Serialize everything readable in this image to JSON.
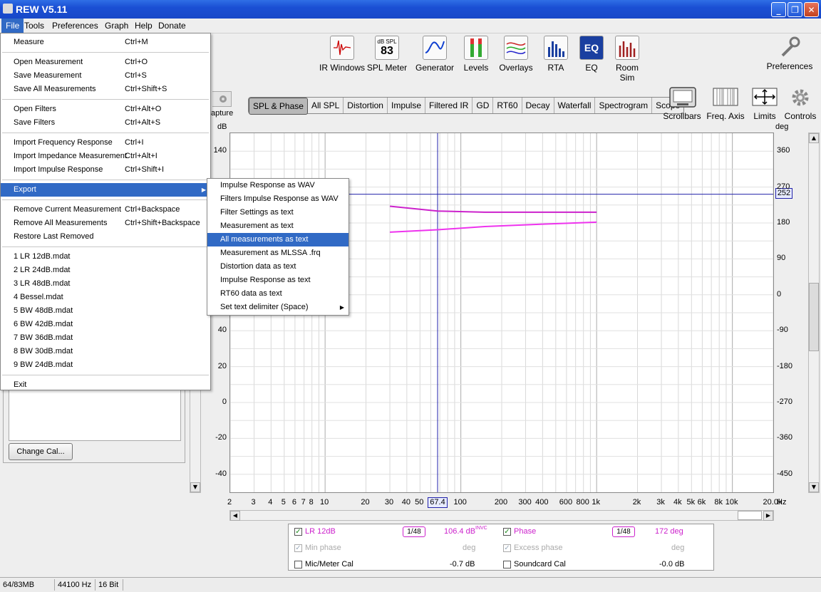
{
  "window": {
    "title": "REW V5.11"
  },
  "menubar": [
    {
      "label": "File",
      "active": true
    },
    {
      "label": "Tools"
    },
    {
      "label": "Preferences"
    },
    {
      "label": "Graph"
    },
    {
      "label": "Help"
    },
    {
      "label": "Donate"
    }
  ],
  "toolbar": {
    "ir_windows": "IR Windows",
    "spl_meter": "SPL Meter",
    "spl_meter_unit": "dB SPL",
    "spl_meter_value": "83",
    "generator": "Generator",
    "levels": "Levels",
    "overlays": "Overlays",
    "rta": "RTA",
    "eq": "EQ",
    "eq_icon_text": "EQ",
    "room_sim": "Room Sim",
    "preferences": "Preferences"
  },
  "capture_label": "apture",
  "tabs": [
    "SPL & Phase",
    "All SPL",
    "Distortion",
    "Impulse",
    "Filtered IR",
    "GD",
    "RT60",
    "Decay",
    "Waterfall",
    "Spectrogram",
    "Scope"
  ],
  "selected_tab": "SPL & Phase",
  "right_tools": {
    "scrollbars": "Scrollbars",
    "freq_axis": "Freq. Axis",
    "limits": "Limits",
    "controls": "Controls"
  },
  "file_menu": {
    "items": [
      {
        "label": "Measure",
        "accel": "Ctrl+M"
      },
      {
        "sep": true
      },
      {
        "label": "Open Measurement",
        "accel": "Ctrl+O"
      },
      {
        "label": "Save Measurement",
        "accel": "Ctrl+S"
      },
      {
        "label": "Save All Measurements",
        "accel": "Ctrl+Shift+S"
      },
      {
        "sep": true
      },
      {
        "label": "Open Filters",
        "accel": "Ctrl+Alt+O"
      },
      {
        "label": "Save Filters",
        "accel": "Ctrl+Alt+S"
      },
      {
        "sep": true
      },
      {
        "label": "Import Frequency Response",
        "accel": "Ctrl+I"
      },
      {
        "label": "Import Impedance Measurement",
        "accel": "Ctrl+Alt+I"
      },
      {
        "label": "Import Impulse Response",
        "accel": "Ctrl+Shift+I"
      },
      {
        "sep": true
      },
      {
        "label": "Export",
        "accel": "",
        "highlight": true,
        "submenu": true
      },
      {
        "sep": true
      },
      {
        "label": "Remove Current Measurement",
        "accel": "Ctrl+Backspace"
      },
      {
        "label": "Remove All Measurements",
        "accel": "Ctrl+Shift+Backspace"
      },
      {
        "label": "Restore Last Removed",
        "accel": ""
      },
      {
        "sep": true
      },
      {
        "label": "1 LR 12dB.mdat",
        "accel": ""
      },
      {
        "label": "2 LR 24dB.mdat",
        "accel": ""
      },
      {
        "label": "3 LR 48dB.mdat",
        "accel": ""
      },
      {
        "label": "4 Bessel.mdat",
        "accel": ""
      },
      {
        "label": "5 BW 48dB.mdat",
        "accel": ""
      },
      {
        "label": "6 BW 42dB.mdat",
        "accel": ""
      },
      {
        "label": "7 BW 36dB.mdat",
        "accel": ""
      },
      {
        "label": "8 BW 30dB.mdat",
        "accel": ""
      },
      {
        "label": "9 BW 24dB.mdat",
        "accel": ""
      },
      {
        "sep": true
      },
      {
        "label": "Exit",
        "accel": ""
      }
    ]
  },
  "export_menu": {
    "items": [
      {
        "label": "Impulse Response as WAV"
      },
      {
        "label": "Filters Impulse Response as WAV"
      },
      {
        "label": "Filter Settings as text"
      },
      {
        "label": "Measurement as text"
      },
      {
        "label": "All measurements as text",
        "highlight": true
      },
      {
        "label": "Measurement as MLSSA .frq"
      },
      {
        "label": "Distortion data as text"
      },
      {
        "label": "Impulse Response as text"
      },
      {
        "label": "RT60 data as text"
      },
      {
        "label": "Set text delimiter (Space)",
        "submenu": true
      }
    ]
  },
  "left_panel": {
    "change_cal": "Change Cal..."
  },
  "graph": {
    "left_unit": "dB",
    "right_unit": "deg",
    "x_unit": "Hz",
    "y_ticks_left": [
      "140",
      "40",
      "20",
      "0",
      "-20",
      "-40"
    ],
    "y_ticks_right": [
      "360",
      "270",
      "180",
      "90",
      "0",
      "-90",
      "-180",
      "-270",
      "-360",
      "-450"
    ],
    "x_ticks": [
      "2",
      "3",
      "4",
      "5",
      "6",
      "7",
      "8",
      "10",
      "20",
      "30",
      "40",
      "50",
      "100",
      "200",
      "300",
      "400",
      "600",
      "800",
      "1k",
      "2k",
      "3k",
      "4k",
      "5k",
      "6k",
      "8k",
      "10k",
      "20.0k"
    ],
    "cursor_x": "67.4",
    "cursor_y_right": "252"
  },
  "chart_data": {
    "type": "line",
    "xlabel": "Hz",
    "ylabel": "dB",
    "y2label": "deg",
    "x_scale": "log",
    "xlim": [
      2,
      20000
    ],
    "y2lim": [
      -495,
      405
    ],
    "series": [
      {
        "name": "LR 12dB",
        "axis": "right",
        "color": "#cc22cc",
        "x": [
          30,
          67.4,
          150,
          400,
          1000
        ],
        "y": [
          222,
          210,
          207,
          207,
          207
        ]
      },
      {
        "name": "Phase",
        "axis": "right",
        "color": "#ee33ee",
        "x": [
          30,
          67.4,
          150,
          400,
          1000
        ],
        "y": [
          157,
          163,
          171,
          177,
          182
        ]
      }
    ]
  },
  "legend": {
    "row1": {
      "name": "LR 12dB",
      "smooth": "1/48",
      "value": "106.4 dB",
      "sup": "INVC",
      "name2": "Phase",
      "smooth2": "1/48",
      "value2": "172 deg"
    },
    "row2": {
      "name": "Min phase",
      "unit": "deg",
      "name2": "Excess phase",
      "unit2": "deg"
    },
    "row3": {
      "name": "Mic/Meter Cal",
      "value": "-0.7 dB",
      "name2": "Soundcard Cal",
      "value2": "-0.0 dB"
    }
  },
  "status": {
    "memory": "64/83MB",
    "rate": "44100 Hz",
    "bits": "16 Bit"
  },
  "colors": {
    "titlebar": "#1a4fd4",
    "highlight": "#316ac5",
    "curve": "#cc22cc",
    "cursor": "#2222aa"
  }
}
